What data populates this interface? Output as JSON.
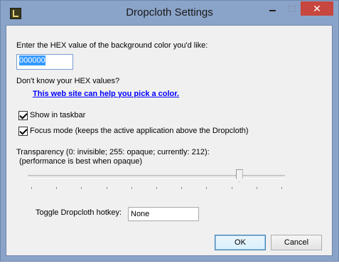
{
  "window": {
    "title": "Dropcloth Settings",
    "icons": {
      "app": "dropcloth-app-icon",
      "minimize": "minimize-icon",
      "maximize": "maximize-icon",
      "close": "close-icon"
    },
    "close_symbol": "✕",
    "colors": {
      "frame": "#8aa3c8",
      "close_button": "#c7463d",
      "client": "#f0f0f0",
      "link": "#0000ff"
    }
  },
  "hex": {
    "label": "Enter the HEX value of the background color you'd like:",
    "value": "000000"
  },
  "help": {
    "question": "Don't know your HEX values?",
    "link_text": "This web site can help you pick a color."
  },
  "options": {
    "show_in_taskbar": {
      "label": "Show in taskbar",
      "checked": true
    },
    "focus_mode": {
      "label": "Focus mode (keeps the active application above the Dropcloth)",
      "checked": true
    }
  },
  "transparency": {
    "label_line1": "Transparency (0: invisible; 255: opaque; currently: 212):",
    "label_line2": "(performance is best when opaque)",
    "min": 0,
    "max": 255,
    "value": 212,
    "tick_count": 11
  },
  "hotkey": {
    "label": "Toggle Dropcloth hotkey:",
    "value": "None"
  },
  "buttons": {
    "ok": "OK",
    "cancel": "Cancel"
  }
}
